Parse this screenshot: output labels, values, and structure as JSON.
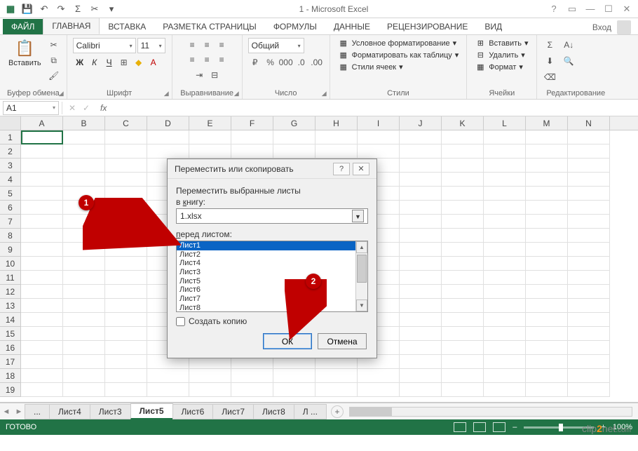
{
  "app": {
    "title": "1 - Microsoft Excel"
  },
  "qat": {
    "save": "💾",
    "undo": "↶",
    "redo": "↷",
    "sum": "Σ",
    "cut": "✂",
    "more": "▾"
  },
  "tabs": {
    "file": "ФАЙЛ",
    "items": [
      "ГЛАВНАЯ",
      "ВСТАВКА",
      "РАЗМЕТКА СТРАНИЦЫ",
      "ФОРМУЛЫ",
      "ДАННЫЕ",
      "РЕЦЕНЗИРОВАНИЕ",
      "ВИД"
    ],
    "login": "Вход"
  },
  "ribbon": {
    "clipboard": {
      "paste": "Вставить",
      "label": "Буфер обмена"
    },
    "font": {
      "name": "Calibri",
      "size": "11",
      "bold": "Ж",
      "italic": "К",
      "underline": "Ч",
      "label": "Шрифт"
    },
    "align": {
      "label": "Выравнивание"
    },
    "number": {
      "format": "Общий",
      "label": "Число"
    },
    "styles": {
      "cond": "Условное форматирование",
      "table": "Форматировать как таблицу",
      "cell": "Стили ячеек",
      "label": "Стили"
    },
    "cells": {
      "insert": "Вставить",
      "delete": "Удалить",
      "format": "Формат",
      "label": "Ячейки"
    },
    "editing": {
      "label": "Редактирование"
    }
  },
  "fbar": {
    "name": "A1"
  },
  "grid": {
    "cols": [
      "A",
      "B",
      "C",
      "D",
      "E",
      "F",
      "G",
      "H",
      "I",
      "J",
      "K",
      "L",
      "M",
      "N"
    ],
    "rows": [
      "1",
      "2",
      "3",
      "4",
      "5",
      "6",
      "7",
      "8",
      "9",
      "10",
      "11",
      "12",
      "13",
      "14",
      "15",
      "16",
      "17",
      "18",
      "19"
    ]
  },
  "sheets": {
    "nav_ellipsis": "...",
    "tabs": [
      "Лист4",
      "Лист3",
      "Лист5",
      "Лист6",
      "Лист7",
      "Лист8"
    ],
    "active": "Лист5",
    "overflow": "Л ...",
    "add": "+"
  },
  "status": {
    "ready": "ГОТОВО",
    "zoom": "100%"
  },
  "dialog": {
    "title": "Переместить или скопировать",
    "move_label": "Переместить выбранные листы",
    "book_label_pre": "в ",
    "book_label_ul": "к",
    "book_label_post": "нигу:",
    "book_value": "1.xlsx",
    "before_label_ul": "п",
    "before_label_post": "еред листом:",
    "list": [
      "Лист1",
      "Лист2",
      "Лист4",
      "Лист3",
      "Лист5",
      "Лист6",
      "Лист7",
      "Лист8"
    ],
    "selected": "Лист1",
    "copy_label_pre": "Создать ",
    "copy_label_ul": "",
    "copy_label_post": "копию",
    "ok": "ОК",
    "cancel": "Отмена",
    "help": "?",
    "close": "✕"
  },
  "annotations": {
    "m1": "1",
    "m2": "2"
  },
  "watermark": {
    "pre": "clip",
    "mid": "2",
    "post": "net",
    "suf": ".com"
  }
}
